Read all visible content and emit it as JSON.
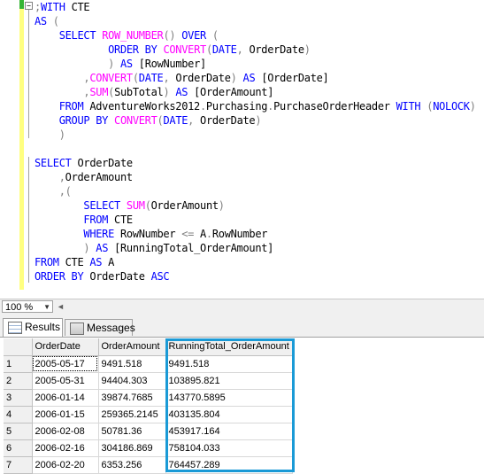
{
  "editor": {
    "lines": [
      [
        {
          "c": "gr",
          "t": ";"
        },
        {
          "c": "kw",
          "t": "WITH"
        },
        {
          "c": "tx",
          "t": " CTE"
        }
      ],
      [
        {
          "c": "kw",
          "t": "AS"
        },
        {
          "c": "tx",
          "t": " "
        },
        {
          "c": "gr",
          "t": "("
        }
      ],
      [
        {
          "c": "tx",
          "t": "    "
        },
        {
          "c": "kw",
          "t": "SELECT"
        },
        {
          "c": "tx",
          "t": " "
        },
        {
          "c": "fn",
          "t": "ROW_NUMBER"
        },
        {
          "c": "gr",
          "t": "()"
        },
        {
          "c": "tx",
          "t": " "
        },
        {
          "c": "kw",
          "t": "OVER"
        },
        {
          "c": "tx",
          "t": " "
        },
        {
          "c": "gr",
          "t": "("
        }
      ],
      [
        {
          "c": "tx",
          "t": "            "
        },
        {
          "c": "kw",
          "t": "ORDER BY"
        },
        {
          "c": "tx",
          "t": " "
        },
        {
          "c": "fn",
          "t": "CONVERT"
        },
        {
          "c": "gr",
          "t": "("
        },
        {
          "c": "kw",
          "t": "DATE"
        },
        {
          "c": "gr",
          "t": ","
        },
        {
          "c": "tx",
          "t": " OrderDate"
        },
        {
          "c": "gr",
          "t": ")"
        }
      ],
      [
        {
          "c": "tx",
          "t": "            "
        },
        {
          "c": "gr",
          "t": ")"
        },
        {
          "c": "tx",
          "t": " "
        },
        {
          "c": "kw",
          "t": "AS"
        },
        {
          "c": "tx",
          "t": " [RowNumber]"
        }
      ],
      [
        {
          "c": "tx",
          "t": "        "
        },
        {
          "c": "gr",
          "t": ","
        },
        {
          "c": "fn",
          "t": "CONVERT"
        },
        {
          "c": "gr",
          "t": "("
        },
        {
          "c": "kw",
          "t": "DATE"
        },
        {
          "c": "gr",
          "t": ","
        },
        {
          "c": "tx",
          "t": " OrderDate"
        },
        {
          "c": "gr",
          "t": ")"
        },
        {
          "c": "tx",
          "t": " "
        },
        {
          "c": "kw",
          "t": "AS"
        },
        {
          "c": "tx",
          "t": " [OrderDate]"
        }
      ],
      [
        {
          "c": "tx",
          "t": "        "
        },
        {
          "c": "gr",
          "t": ","
        },
        {
          "c": "fn",
          "t": "SUM"
        },
        {
          "c": "gr",
          "t": "("
        },
        {
          "c": "tx",
          "t": "SubTotal"
        },
        {
          "c": "gr",
          "t": ")"
        },
        {
          "c": "tx",
          "t": " "
        },
        {
          "c": "kw",
          "t": "AS"
        },
        {
          "c": "tx",
          "t": " [OrderAmount]"
        }
      ],
      [
        {
          "c": "tx",
          "t": "    "
        },
        {
          "c": "kw",
          "t": "FROM"
        },
        {
          "c": "tx",
          "t": " AdventureWorks2012"
        },
        {
          "c": "gr",
          "t": "."
        },
        {
          "c": "tx",
          "t": "Purchasing"
        },
        {
          "c": "gr",
          "t": "."
        },
        {
          "c": "tx",
          "t": "PurchaseOrderHeader "
        },
        {
          "c": "kw",
          "t": "WITH"
        },
        {
          "c": "tx",
          "t": " "
        },
        {
          "c": "gr",
          "t": "("
        },
        {
          "c": "kw",
          "t": "NOLOCK"
        },
        {
          "c": "gr",
          "t": ")"
        }
      ],
      [
        {
          "c": "tx",
          "t": "    "
        },
        {
          "c": "kw",
          "t": "GROUP BY"
        },
        {
          "c": "tx",
          "t": " "
        },
        {
          "c": "fn",
          "t": "CONVERT"
        },
        {
          "c": "gr",
          "t": "("
        },
        {
          "c": "kw",
          "t": "DATE"
        },
        {
          "c": "gr",
          "t": ","
        },
        {
          "c": "tx",
          "t": " OrderDate"
        },
        {
          "c": "gr",
          "t": ")"
        }
      ],
      [
        {
          "c": "tx",
          "t": "    "
        },
        {
          "c": "gr",
          "t": ")"
        }
      ],
      [],
      [
        {
          "c": "kw",
          "t": "SELECT"
        },
        {
          "c": "tx",
          "t": " OrderDate"
        }
      ],
      [
        {
          "c": "tx",
          "t": "    "
        },
        {
          "c": "gr",
          "t": ","
        },
        {
          "c": "tx",
          "t": "OrderAmount"
        }
      ],
      [
        {
          "c": "tx",
          "t": "    "
        },
        {
          "c": "gr",
          "t": ",("
        }
      ],
      [
        {
          "c": "tx",
          "t": "        "
        },
        {
          "c": "kw",
          "t": "SELECT"
        },
        {
          "c": "tx",
          "t": " "
        },
        {
          "c": "fn",
          "t": "SUM"
        },
        {
          "c": "gr",
          "t": "("
        },
        {
          "c": "tx",
          "t": "OrderAmount"
        },
        {
          "c": "gr",
          "t": ")"
        }
      ],
      [
        {
          "c": "tx",
          "t": "        "
        },
        {
          "c": "kw",
          "t": "FROM"
        },
        {
          "c": "tx",
          "t": " CTE"
        }
      ],
      [
        {
          "c": "tx",
          "t": "        "
        },
        {
          "c": "kw",
          "t": "WHERE"
        },
        {
          "c": "tx",
          "t": " RowNumber "
        },
        {
          "c": "gr",
          "t": "<="
        },
        {
          "c": "tx",
          "t": " A"
        },
        {
          "c": "gr",
          "t": "."
        },
        {
          "c": "tx",
          "t": "RowNumber"
        }
      ],
      [
        {
          "c": "tx",
          "t": "        "
        },
        {
          "c": "gr",
          "t": ")"
        },
        {
          "c": "tx",
          "t": " "
        },
        {
          "c": "kw",
          "t": "AS"
        },
        {
          "c": "tx",
          "t": " [RunningTotal_OrderAmount]"
        }
      ],
      [
        {
          "c": "kw",
          "t": "FROM"
        },
        {
          "c": "tx",
          "t": " CTE "
        },
        {
          "c": "kw",
          "t": "AS"
        },
        {
          "c": "tx",
          "t": " A"
        }
      ],
      [
        {
          "c": "kw",
          "t": "ORDER BY"
        },
        {
          "c": "tx",
          "t": " OrderDate "
        },
        {
          "c": "kw",
          "t": "ASC"
        }
      ]
    ],
    "collapse_glyph": "−"
  },
  "zoom": {
    "value": "100 %"
  },
  "tabs": [
    {
      "label": "Results",
      "icon": "grid-icon"
    },
    {
      "label": "Messages",
      "icon": "messages-icon"
    }
  ],
  "results": {
    "columns": [
      "OrderDate",
      "OrderAmount",
      "RunningTotal_OrderAmount"
    ],
    "rows": [
      [
        "1",
        "2005-05-17",
        "9491.518",
        "9491.518"
      ],
      [
        "2",
        "2005-05-31",
        "94404.303",
        "103895.821"
      ],
      [
        "3",
        "2006-01-14",
        "39874.7685",
        "143770.5895"
      ],
      [
        "4",
        "2006-01-15",
        "259365.2145",
        "403135.804"
      ],
      [
        "5",
        "2006-02-08",
        "50781.36",
        "453917.164"
      ],
      [
        "6",
        "2006-02-16",
        "304186.869",
        "758104.033"
      ],
      [
        "7",
        "2006-02-20",
        "6353.256",
        "764457.289"
      ]
    ]
  },
  "colors": {
    "highlight": "#1a9ad6",
    "keyword": "#0000ff",
    "function": "#ff00ff",
    "operator": "#808080"
  }
}
